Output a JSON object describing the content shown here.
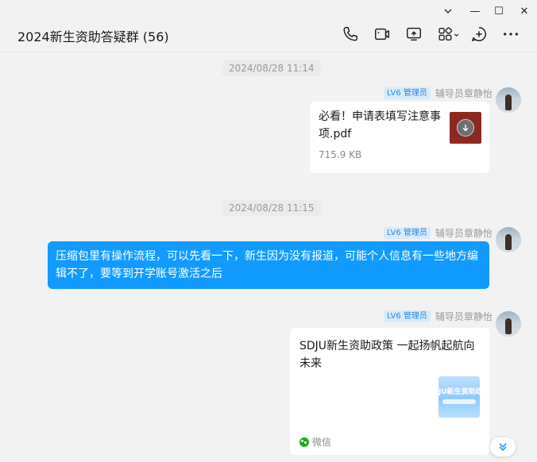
{
  "window": {
    "minimize_icon": "chevron-down-icon",
    "minimize": "—",
    "maximize": "☐",
    "close": "✕"
  },
  "header": {
    "title": "2024新生资助答疑群 (56)",
    "tools": [
      "phone-icon",
      "video-icon",
      "screen-share-icon",
      "apps-icon",
      "add-icon",
      "more-icon"
    ]
  },
  "messages": [
    {
      "timestamp": "2024/08/28 11:14",
      "badge": "LV6 管理员",
      "sender": "辅导员章静怡",
      "type": "file",
      "file_name": "必看！申请表填写注意事项.pdf",
      "file_size": "715.9 KB"
    },
    {
      "timestamp": "2024/08/28 11:15",
      "badge": "LV6 管理员",
      "sender": "辅导员章静怡",
      "type": "text",
      "text": "压缩包里有操作流程，可以先看一下，新生因为没有报道，可能个人信息有一些地方编辑不了，要等到开学账号激活之后"
    },
    {
      "badge": "LV6 管理员",
      "sender": "辅导员章静怡",
      "type": "link",
      "link_title": "SDJU新生资助政策  一起扬帆起航向未来",
      "thumb_text": "JU新生资助政",
      "source": "微信"
    }
  ],
  "colors": {
    "accent": "#129bff",
    "badge_text": "#2e88d6",
    "badge_bg": "#d6ebfb",
    "file_icon": "#8c2a22"
  }
}
